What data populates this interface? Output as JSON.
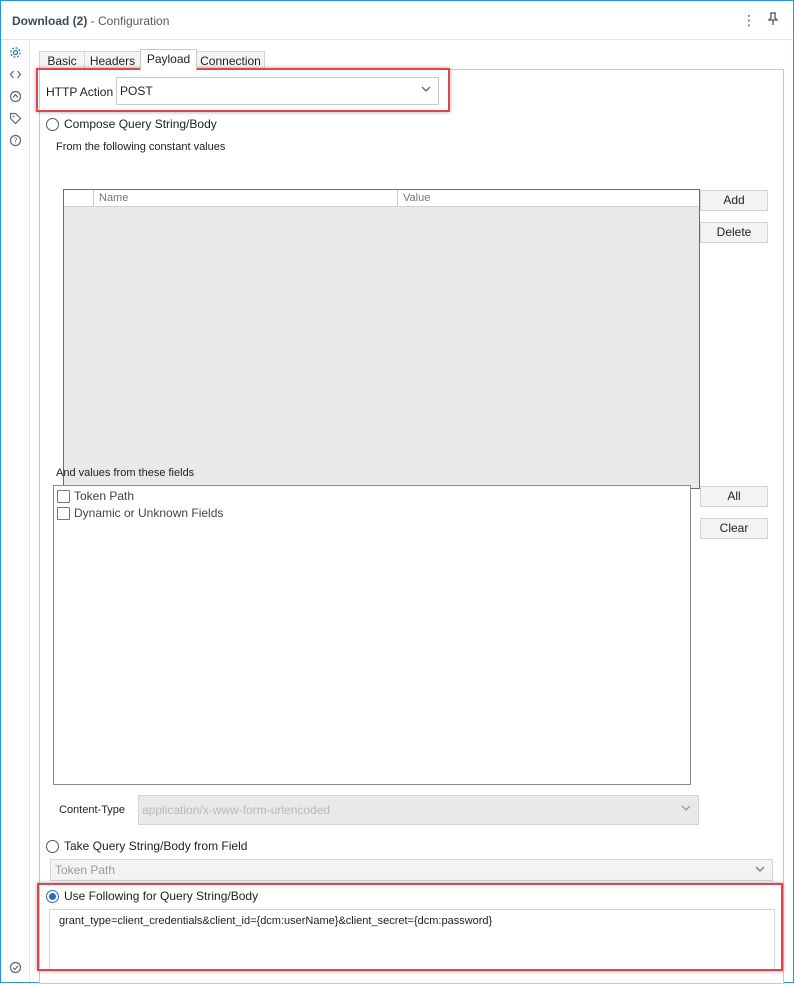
{
  "window": {
    "title_strong": "Download (2)",
    "title_rest": " - Configuration"
  },
  "sidebar": {
    "icons": [
      "gear-icon",
      "code-icon",
      "connection-icon",
      "tag-icon",
      "help-icon",
      "status-check-icon"
    ]
  },
  "tabs": [
    {
      "label": "Basic"
    },
    {
      "label": "Headers"
    },
    {
      "label": "Payload"
    },
    {
      "label": "Connection"
    }
  ],
  "http_action": {
    "label": "HTTP Action",
    "value": "POST"
  },
  "compose": {
    "label": "Compose Query String/Body",
    "selected": false,
    "constants_label": "From the following constant values",
    "columns": [
      "Name",
      "Value"
    ],
    "add_label": "Add",
    "delete_label": "Delete",
    "fields_label": "And values from these fields",
    "fields": [
      {
        "label": "Token Path",
        "checked": false
      },
      {
        "label": "Dynamic or Unknown Fields",
        "checked": false
      }
    ],
    "all_label": "All",
    "clear_label": "Clear",
    "content_type_label": "Content-Type",
    "content_type_value": "application/x-www-form-urlencoded"
  },
  "from_field": {
    "label": "Take Query String/Body from Field",
    "selected": false,
    "value": "Token Path"
  },
  "use_following": {
    "label": "Use Following for Query String/Body",
    "selected": true,
    "text": "grant_type=client_credentials&client_id={dcm:userName}&client_secret={dcm:password}"
  },
  "colors": {
    "accent": "#2a6fb5",
    "highlight": "#e0454d",
    "frame": "#1e9bd7"
  }
}
